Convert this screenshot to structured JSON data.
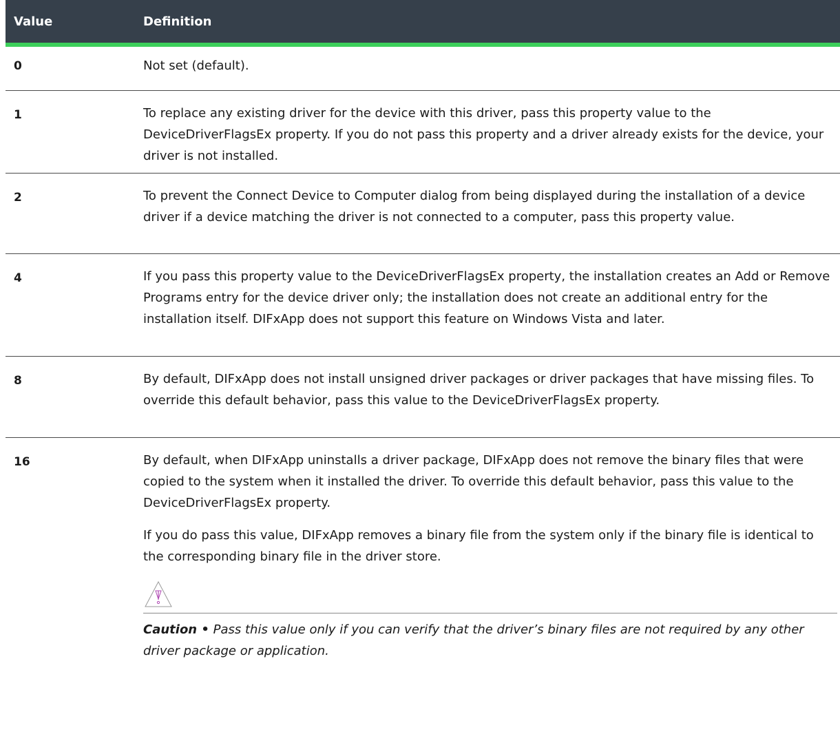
{
  "header": {
    "col_value": "Value",
    "col_definition": "Definition"
  },
  "rows": [
    {
      "value": "0",
      "definition": [
        "Not set (default)."
      ]
    },
    {
      "value": "1",
      "definition": [
        "To replace any existing driver for the device with this driver, pass this property value to the DeviceDriverFlagsEx property. If you do not pass this property and a driver already exists for the device, your driver is not installed."
      ]
    },
    {
      "value": "2",
      "definition": [
        "To prevent the Connect Device to Computer dialog from being displayed during the installation of a device driver if a device matching the driver is not connected to a computer, pass this property value."
      ]
    },
    {
      "value": "4",
      "definition": [
        "If you pass this property value to the DeviceDriverFlagsEx property, the installation creates an Add or Remove Programs entry for the device driver only; the installation does not create an additional entry for the installation itself. DIFxApp does not support this feature on Windows Vista and later."
      ]
    },
    {
      "value": "8",
      "definition": [
        "By default, DIFxApp does not install unsigned driver packages or driver packages that have missing files. To override this default behavior, pass this value to the DeviceDriverFlagsEx property."
      ]
    },
    {
      "value": "16",
      "definition": [
        "By default, when DIFxApp uninstalls a driver package, DIFxApp does not remove the binary files that were copied to the system when it installed the driver. To override this default behavior, pass this value to the DeviceDriverFlagsEx property.",
        "If you do pass this value, DIFxApp removes a binary file from the system only if the binary file is identical to the corresponding binary file in the driver store."
      ],
      "caution": {
        "icon": "caution-triangle-icon",
        "label": "Caution •",
        "text": "Pass this value only if you can verify that the driver’s binary files are not required by any other driver package or application."
      }
    }
  ],
  "colors": {
    "header_bg": "#36404b",
    "header_accent": "#3ccf5a",
    "icon_accent": "#b04bb4"
  }
}
